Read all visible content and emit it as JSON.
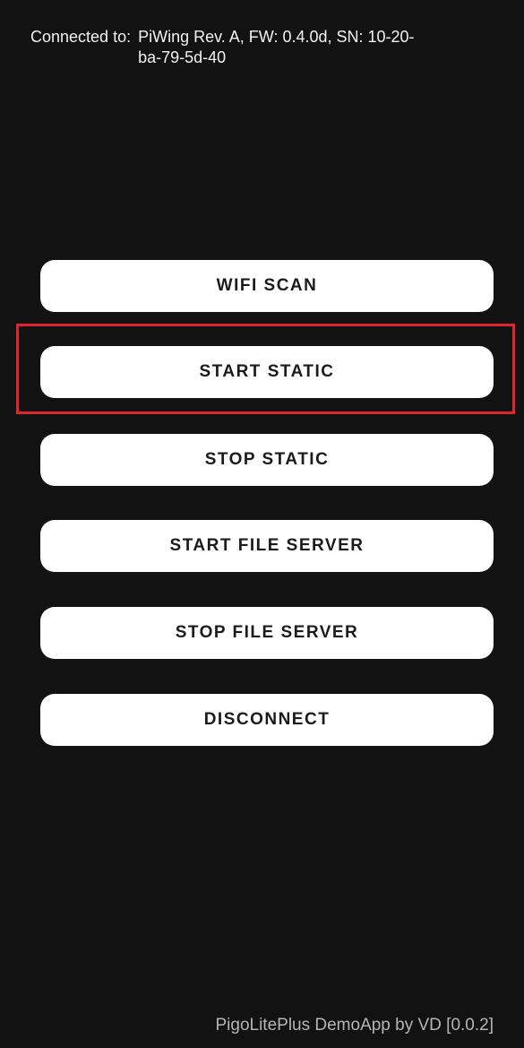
{
  "connection": {
    "label": "Connected to:",
    "value": "PiWing Rev. A, FW: 0.4.0d, SN: 10-20-ba-79-5d-40"
  },
  "buttons": {
    "wifi_scan": "WIFI SCAN",
    "start_static": "START STATIC",
    "stop_static": "STOP STATIC",
    "start_file_server": "START FILE SERVER",
    "stop_file_server": "STOP FILE SERVER",
    "disconnect": "DISCONNECT"
  },
  "footer": {
    "text": "PigoLitePlus DemoApp by VD [0.0.2]"
  },
  "colors": {
    "background": "#121212",
    "button_background": "#ffffff",
    "button_text": "#1b1b1b",
    "highlight": "#e0242b",
    "footer_text": "#b5b5b5"
  },
  "highlighted_button": "start_static"
}
